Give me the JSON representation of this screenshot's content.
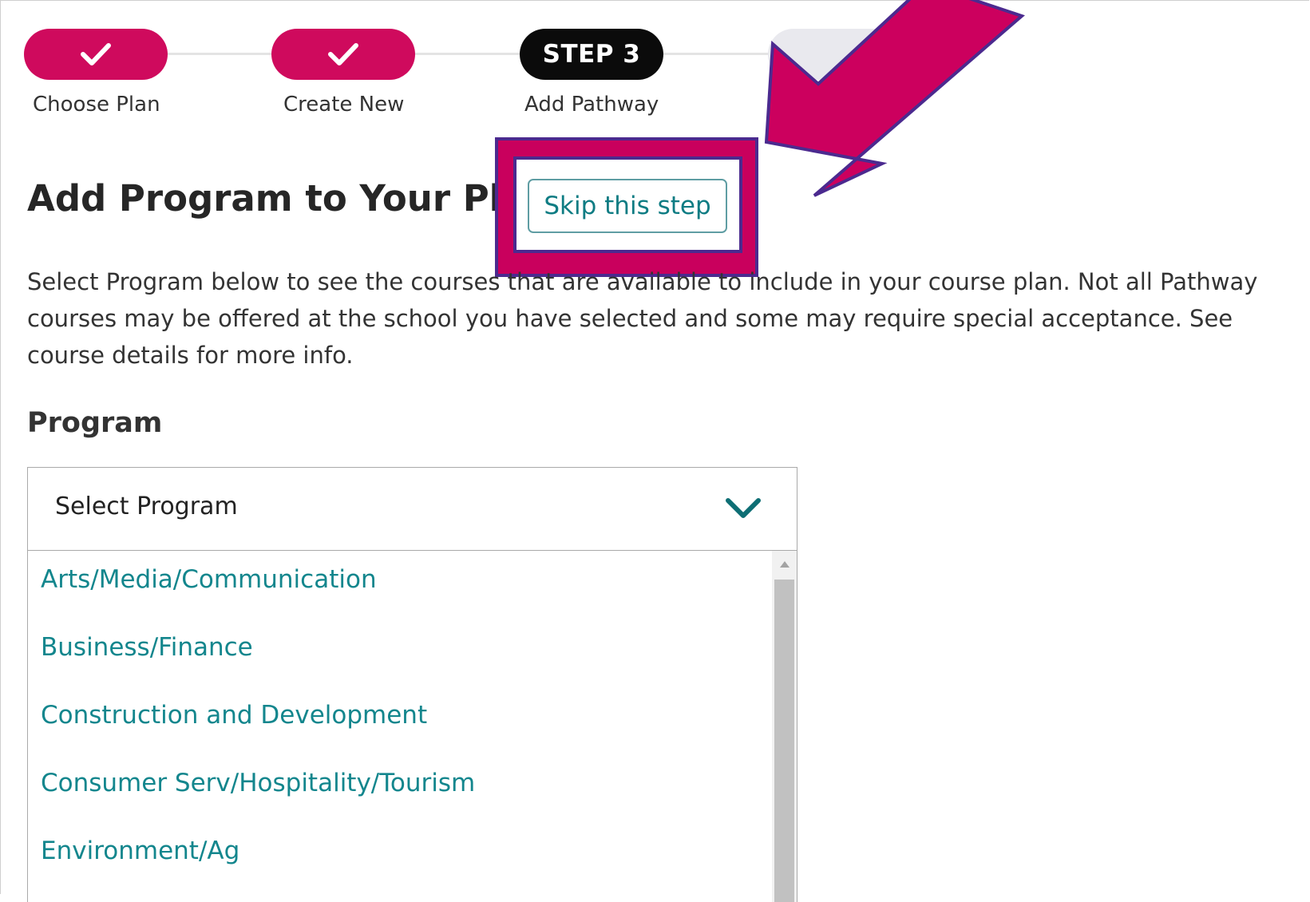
{
  "stepper": {
    "steps": [
      {
        "label": "Choose Plan",
        "state": "done",
        "icon": "check-icon"
      },
      {
        "label": "Create New",
        "state": "done",
        "icon": "check-icon"
      },
      {
        "label": "Add Pathway",
        "state": "current",
        "badge": "STEP 3"
      },
      {
        "label": "",
        "state": "upcoming"
      }
    ]
  },
  "main": {
    "title": "Add Program to Your Plan",
    "skip_label": "Skip this step",
    "description": "Select Program below to see the courses that are available to include in your course plan. Not all Pathway courses may be offered at the school you have selected and some may require special acceptance. See course details for more info."
  },
  "program": {
    "label": "Program",
    "selected": "Select Program",
    "options": [
      "Arts/Media/Communication",
      "Business/Finance",
      "Construction and Development",
      "Consumer Serv/Hospitality/Tourism",
      "Environment/Ag"
    ]
  },
  "colors": {
    "brand_pink": "#cf0a5d",
    "teal_link": "#13868d",
    "annotation_magenta": "#c9005d",
    "annotation_purple": "#4b2a8f"
  }
}
